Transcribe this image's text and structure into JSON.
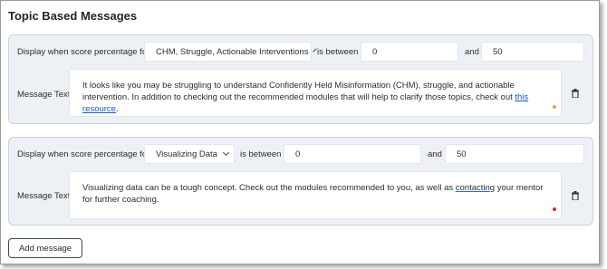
{
  "section_title": "Topic Based Messages",
  "rules": [
    {
      "display_label": "Display when score percentage for",
      "topic_select": "CHM, Struggle, Actionable Interventions",
      "between_label": "is between",
      "min_value": "0",
      "and_label": "and",
      "max_value": "50",
      "message_label": "Message Text",
      "message_before_link": "It looks like you may be struggling to understand Confidently Held Misinformation (CHM), struggle, and actionable intervention. In addition to checking out the recommended modules that will help to clarify those topics, check out ",
      "message_link": "this resource",
      "message_after_link": ".",
      "status_color": "#f2994a"
    },
    {
      "display_label": "Display when score percentage for",
      "topic_select": "Visualizing Data",
      "between_label": "is between",
      "min_value": "0",
      "and_label": "and",
      "max_value": "50",
      "message_label": "Message Text",
      "message_before_underline": "Visualizing data can be a tough concept. Check out the modules recommended to you, as well as ",
      "message_underlined": "contacting",
      "message_after_underline": " your mentor for further coaching.",
      "status_color": "#d0312d"
    }
  ],
  "add_button_label": "Add message",
  "icons": {
    "delete": "trash-icon",
    "dropdown": "chevron-down-icon"
  }
}
